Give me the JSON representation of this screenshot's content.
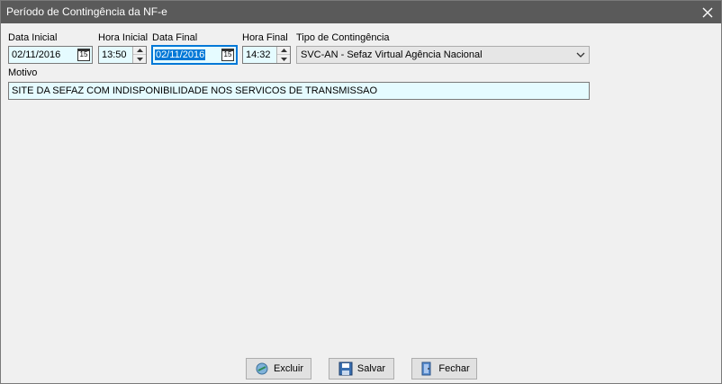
{
  "window": {
    "title": "Período de Contingência da NF-e",
    "close_glyph": "✕"
  },
  "form": {
    "data_inicial": {
      "label": "Data Inicial",
      "value": "02/11/2016",
      "calendar_icon_text": "15"
    },
    "hora_inicial": {
      "label": "Hora Inicial",
      "value": "13:50"
    },
    "data_final": {
      "label": "Data Final",
      "value": "02/11/2016",
      "calendar_icon_text": "15"
    },
    "hora_final": {
      "label": "Hora Final",
      "value": "14:32"
    },
    "tipo_contingencia": {
      "label": "Tipo de Contingência",
      "value": "SVC-AN - Sefaz Virtual Agência Nacional"
    },
    "motivo": {
      "label": "Motivo",
      "value": "SITE DA SEFAZ COM INDISPONIBILIDADE NOS SERVICOS DE TRANSMISSAO"
    }
  },
  "buttons": {
    "excluir": {
      "label": "Excluir",
      "icon": "delete-icon"
    },
    "salvar": {
      "label": "Salvar",
      "icon": "floppy-disk-icon"
    },
    "fechar": {
      "label": "Fechar",
      "icon": "door-exit-icon"
    }
  },
  "colors": {
    "titlebar": "#5a5a5a",
    "field_bg": "#e5fbff",
    "selection": "#0078d7",
    "window_bg": "#f0f0f0"
  }
}
